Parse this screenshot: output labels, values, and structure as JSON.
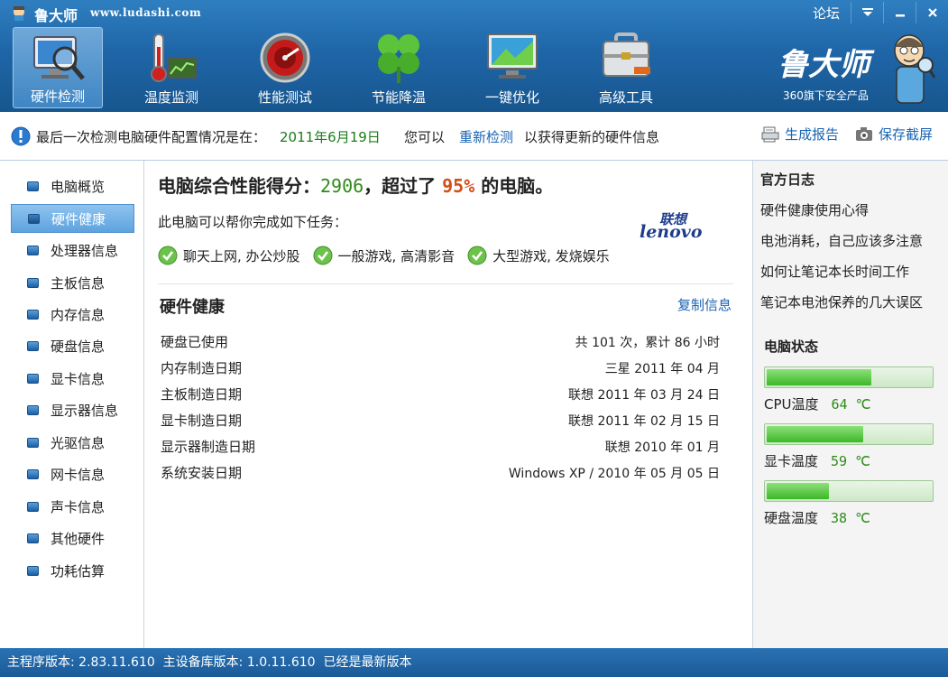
{
  "window": {
    "app_name": "鲁大师",
    "url": "www.ludashi.com",
    "forum": "论坛",
    "menu_icon": "menu-icon",
    "minimize_icon": "minimize-icon",
    "close_icon": "close-icon"
  },
  "toolbar": [
    {
      "label": "硬件检测",
      "icon": "monitor-magnifier-icon"
    },
    {
      "label": "温度监测",
      "icon": "thermometer-icon"
    },
    {
      "label": "性能测试",
      "icon": "speedometer-icon"
    },
    {
      "label": "节能降温",
      "icon": "clover-icon"
    },
    {
      "label": "一键优化",
      "icon": "optimize-monitor-icon"
    },
    {
      "label": "高级工具",
      "icon": "toolbox-icon"
    }
  ],
  "brand": {
    "text": "鲁大师",
    "sub": "360旗下安全产品"
  },
  "infobar": {
    "prefix": "最后一次检测电脑硬件配置情况是在：",
    "date": "2011年6月19日",
    "can": "您可以",
    "recheck": "重新检测",
    "suffix": "以获得更新的硬件信息",
    "report": "生成报告",
    "screenshot": "保存截屏"
  },
  "sidebar": {
    "items": [
      {
        "label": "电脑概览"
      },
      {
        "label": "硬件健康"
      },
      {
        "label": "处理器信息"
      },
      {
        "label": "主板信息"
      },
      {
        "label": "内存信息"
      },
      {
        "label": "硬盘信息"
      },
      {
        "label": "显卡信息"
      },
      {
        "label": "显示器信息"
      },
      {
        "label": "光驱信息"
      },
      {
        "label": "网卡信息"
      },
      {
        "label": "声卡信息"
      },
      {
        "label": "其他硬件"
      },
      {
        "label": "功耗估算"
      }
    ],
    "selected_index": 1
  },
  "main": {
    "score_prefix": "电脑综合性能得分：",
    "score": "2906",
    "score_mid": "，超过了",
    "percent": "95%",
    "score_suffix": "的电脑。",
    "help_text": "此电脑可以帮你完成如下任务：",
    "brand_cn": "联想",
    "brand_en": "lenovo",
    "tasks": [
      {
        "label": "聊天上网, 办公炒股"
      },
      {
        "label": "一般游戏, 高清影音"
      },
      {
        "label": "大型游戏, 发烧娱乐"
      }
    ],
    "section_title": "硬件健康",
    "copy_link": "复制信息",
    "rows": [
      {
        "label": "硬盘已使用",
        "value": "共 101 次，累计 86 小时"
      },
      {
        "label": "内存制造日期",
        "value": "三星 2011 年 04 月"
      },
      {
        "label": "主板制造日期",
        "value": "联想 2011 年 03 月 24 日"
      },
      {
        "label": "显卡制造日期",
        "value": "联想 2011 年 02 月 15 日"
      },
      {
        "label": "显示器制造日期",
        "value": "联想 2010 年 01 月"
      },
      {
        "label": "系统安装日期",
        "value": "Windows XP / 2010 年 05 月 05 日"
      }
    ]
  },
  "right": {
    "blog_title": "官方日志",
    "news": [
      {
        "label": "硬件健康使用心得"
      },
      {
        "label": "电池消耗，自己应该多注意"
      },
      {
        "label": "如何让笔记本长时间工作"
      },
      {
        "label": "笔记本电池保养的几大误区"
      }
    ],
    "status_title": "电脑状态",
    "temps": [
      {
        "label": "CPU温度",
        "value": "64 ℃",
        "level": 0.64
      },
      {
        "label": "显卡温度",
        "value": "59 ℃",
        "level": 0.59
      },
      {
        "label": "硬盘温度",
        "value": "38 ℃",
        "level": 0.38
      }
    ]
  },
  "status": {
    "text": "主程序版本: 2.83.11.610  主设备库版本: 1.0.11.610  已经是最新版本"
  },
  "colors": {
    "header": "#1f66a8",
    "accent_green": "#2f8a1a",
    "accent_orange": "#d2501a",
    "link": "#1a64b4"
  }
}
